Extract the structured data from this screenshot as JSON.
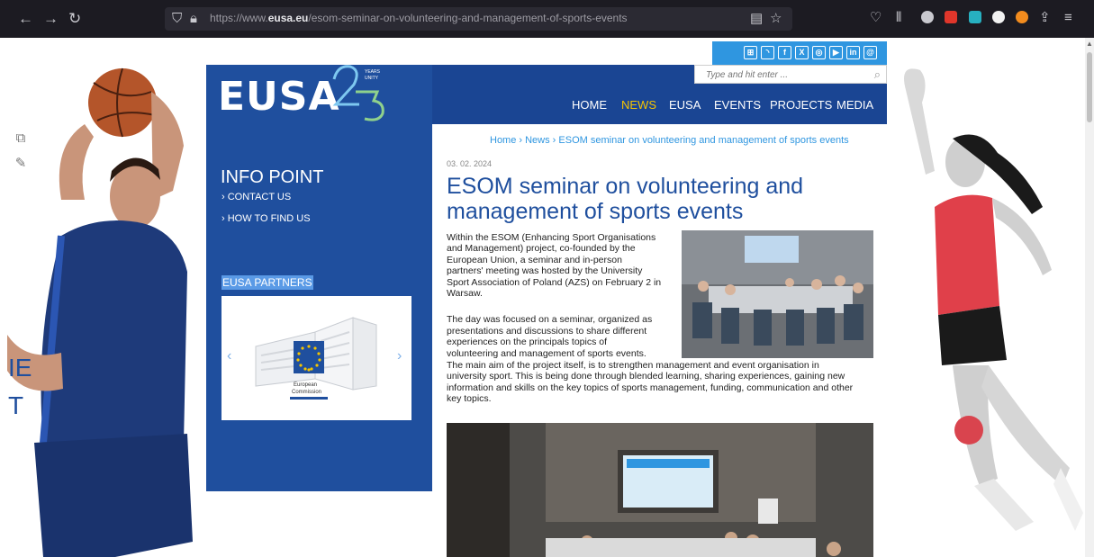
{
  "browser": {
    "url_prefix": "https://www.",
    "url_domain": "eusa.eu",
    "url_path": "/esom-seminar-on-volunteering-and-management-of-sports-events"
  },
  "site": {
    "logo": "EUSA",
    "logo_badge": "YEARS OF UNITY",
    "search_placeholder": "Type and hit enter ...",
    "nav": [
      "HOME",
      "NEWS",
      "EUSA",
      "EVENTS",
      "PROJECTS",
      "MEDIA"
    ],
    "active_nav": "NEWS",
    "social_icons": [
      "sitemap-icon",
      "rss-icon",
      "facebook-icon",
      "x-icon",
      "instagram-icon",
      "youtube-icon",
      "linkedin-icon",
      "threads-icon"
    ]
  },
  "sidebar": {
    "info_title": "INFO POINT",
    "links": [
      "› CONTACT US",
      "› HOW TO FIND US"
    ],
    "partners_label": "EUSA PARTNERS",
    "partner": "European Commission",
    "partner_line1": "European",
    "partner_line2": "Commission"
  },
  "side_letters": [
    "IE",
    "T"
  ],
  "article": {
    "breadcrumb": "Home  ›  News  ›  ESOM seminar on volunteering and management of sports events",
    "date": "03. 02. 2024",
    "title": "ESOM seminar on volunteering and management of sports events",
    "paragraph1": [
      "Within the ESOM (Enhancing Sport Organisations",
      "and Management) project, co-founded by the",
      "European Union, a seminar and in-person",
      "partners' meeting was hosted by the University",
      "Sport Association of Poland (AZS) on February 2 in",
      "Warsaw."
    ],
    "paragraph2": [
      "The day was focused on a seminar, organized as",
      "presentations and discussions to share different",
      "experiences on the principals topics of",
      "volunteering and management of sports events."
    ],
    "paragraph3": [
      "The main aim of the project itself, is to strengthen management and event organisation in",
      "university sport. This is being done through blended learning, sharing experiences, gaining new",
      "information and skills on the key topics of sports management, funding, communication and other",
      "key topics."
    ]
  },
  "colors": {
    "brand_blue": "#1f4f9e",
    "header_blue": "#1a4593",
    "accent_blue": "#2f96e0",
    "active_yellow": "#f5c400"
  }
}
